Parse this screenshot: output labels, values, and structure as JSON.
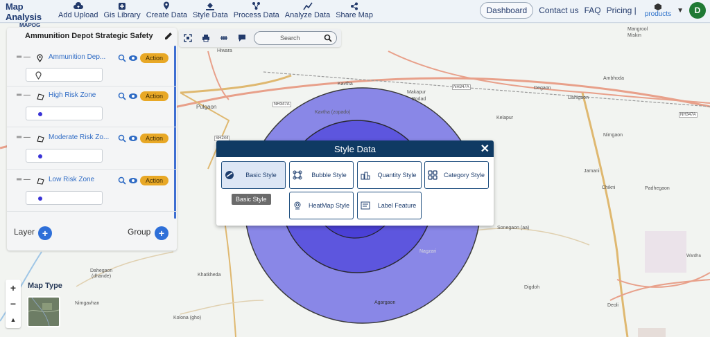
{
  "app": {
    "name": "Map Analysis",
    "sub": "MAPOG"
  },
  "nav": [
    {
      "label": "Add Upload",
      "icon": "cloud-upload-icon"
    },
    {
      "label": "Gis Library",
      "icon": "library-icon"
    },
    {
      "label": "Create Data",
      "icon": "map-pin-icon"
    },
    {
      "label": "Style Data",
      "icon": "paint-bucket-icon"
    },
    {
      "label": "Process Data",
      "icon": "process-icon"
    },
    {
      "label": "Analyze Data",
      "icon": "analyze-icon"
    },
    {
      "label": "Share Map",
      "icon": "share-icon"
    }
  ],
  "right_nav": {
    "dashboard": "Dashboard",
    "contact": "Contact us",
    "faq": "FAQ",
    "pricing": "Pricing |",
    "products": "products",
    "avatar": "D"
  },
  "panel": {
    "title": "Ammunition Depot Strategic Safety",
    "layers": [
      {
        "name": "Ammunition Dep...",
        "action": "Action",
        "kind": "point"
      },
      {
        "name": "High Risk Zone",
        "action": "Action",
        "kind": "polygon"
      },
      {
        "name": "Moderate Risk Zo...",
        "action": "Action",
        "kind": "polygon"
      },
      {
        "name": "Low Risk Zone",
        "action": "Action",
        "kind": "polygon"
      }
    ],
    "layer_label": "Layer",
    "group_label": "Group"
  },
  "toolbar": {
    "search_placeholder": "Search"
  },
  "map_type": {
    "label": "Map Type"
  },
  "zoom": {
    "plus": "+",
    "minus": "−"
  },
  "modal": {
    "title": "Style Data",
    "close": "✕",
    "buttons": [
      {
        "label": "Basic Style"
      },
      {
        "label": "Bubble Style"
      },
      {
        "label": "Quantity Style"
      },
      {
        "label": "Category Style"
      },
      {
        "label": "HeatMap Style"
      },
      {
        "label": "Label Feature"
      }
    ],
    "tooltip": "Basic Style"
  },
  "map_labels": {
    "hiwara": "Hiwara",
    "kavtha": "Kavtha",
    "makapur": "Makapur",
    "bodad": "Bodad",
    "pulgaon": "Pulgaon",
    "kavtha_zopado": "Kavtha (zopado)",
    "kelapur": "Kelapur",
    "degaon": "Degaon",
    "dahigaon": "Dahigaon",
    "mangrool": "Mangrool",
    "miskin": "Miskin",
    "ambhoda": "Ambhoda",
    "nimgaon": "Nimgaon",
    "jamani": "Jamani",
    "chikni": "Chikni",
    "padhegaon": "Padhegaon",
    "sonegaon": "Sonegaon (aa)",
    "nagzari": "Nagzari",
    "digdoh": "Digdoh",
    "agargaon": "Agargaon",
    "deoli": "Deoli",
    "dahegaon": "Dahegaon",
    "dhande": "(dhande)",
    "nimgavhan": "Nimgavhan",
    "khatkheda": "Khatkheda",
    "kolona": "Kolona (gho)",
    "wardha": "Wardha",
    "nh347a_1": "NH347A",
    "nh347a_2": "NH347A",
    "nh347a_3": "NH347A",
    "sh244": "SH244"
  },
  "colors": {
    "zone_outer": "#7b78e6",
    "zone_mid": "#5a52de",
    "zone_inner": "#4a3fd6",
    "header": "#0f3a63",
    "action": "#e8a826"
  }
}
